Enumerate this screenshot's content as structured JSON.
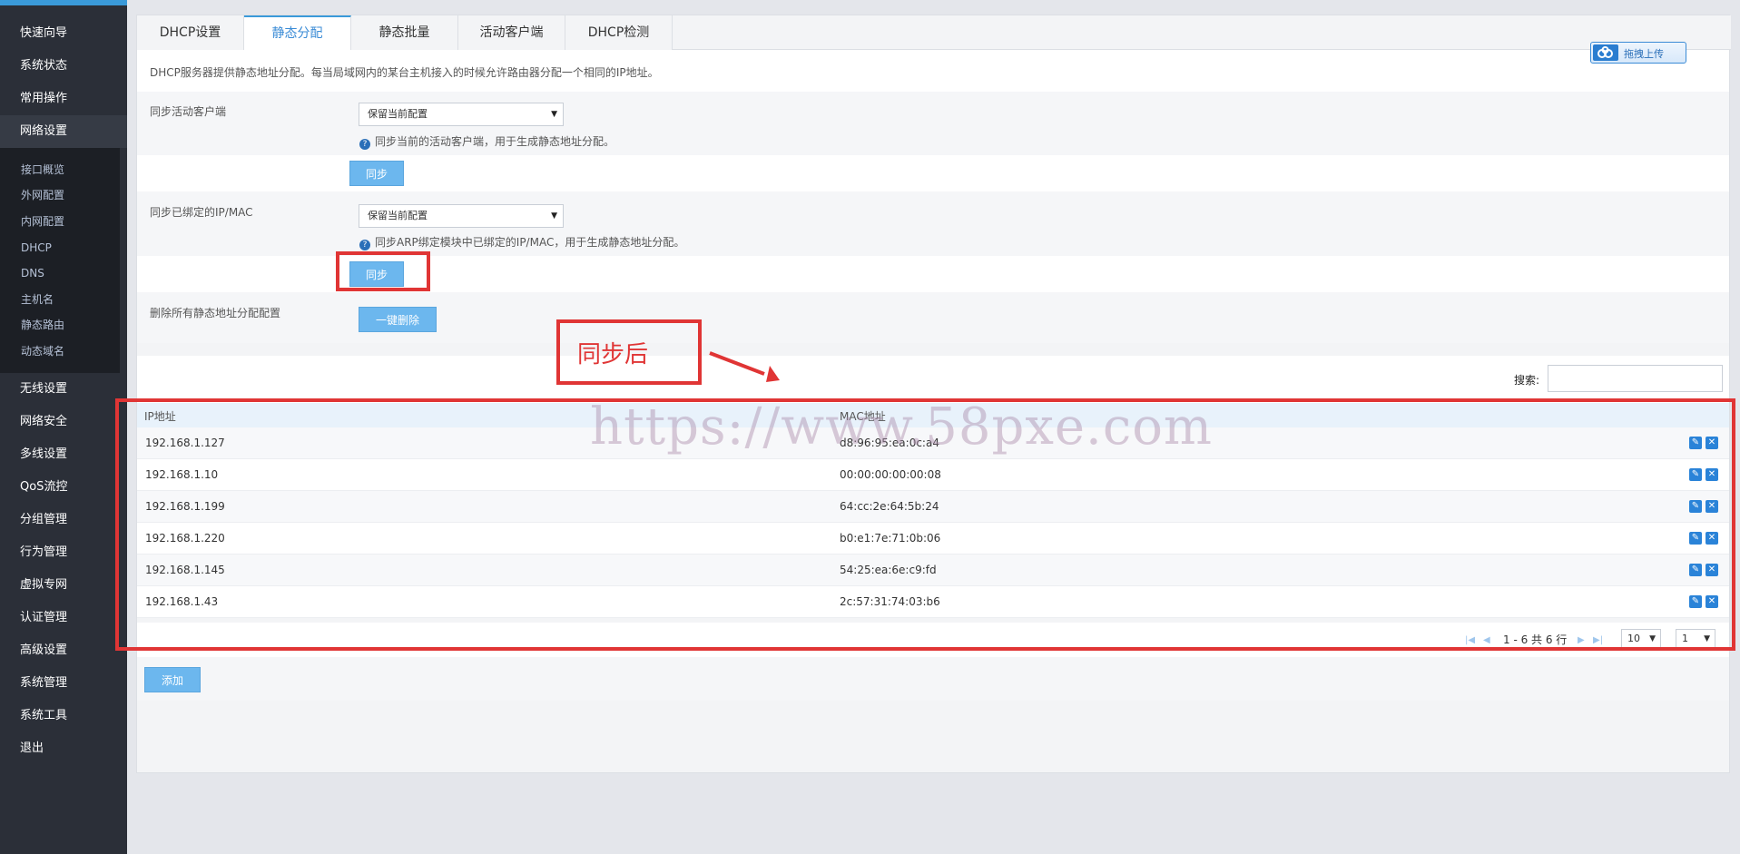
{
  "sidebar": {
    "items": [
      {
        "label": "快速向导"
      },
      {
        "label": "系统状态"
      },
      {
        "label": "常用操作"
      },
      {
        "label": "网络设置"
      },
      {
        "label": "无线设置"
      },
      {
        "label": "网络安全"
      },
      {
        "label": "多线设置"
      },
      {
        "label": "QoS流控"
      },
      {
        "label": "分组管理"
      },
      {
        "label": "行为管理"
      },
      {
        "label": "虚拟专网"
      },
      {
        "label": "认证管理"
      },
      {
        "label": "高级设置"
      },
      {
        "label": "系统管理"
      },
      {
        "label": "系统工具"
      },
      {
        "label": "退出"
      }
    ],
    "submenu": [
      {
        "label": "接口概览"
      },
      {
        "label": "外网配置"
      },
      {
        "label": "内网配置"
      },
      {
        "label": "DHCP"
      },
      {
        "label": "DNS"
      },
      {
        "label": "主机名"
      },
      {
        "label": "静态路由"
      },
      {
        "label": "动态域名"
      }
    ]
  },
  "tabs": [
    {
      "label": "DHCP设置"
    },
    {
      "label": "静态分配"
    },
    {
      "label": "静态批量"
    },
    {
      "label": "活动客户端"
    },
    {
      "label": "DHCP检测"
    }
  ],
  "upload": {
    "label": "拖拽上传"
  },
  "description": "DHCP服务器提供静态地址分配。每当局域网内的某台主机接入的时候允许路由器分配一个相同的IP地址。",
  "sync_active": {
    "label": "同步活动客户端",
    "select_value": "保留当前配置",
    "hint": "同步当前的活动客户端，用于生成静态地址分配。",
    "button": "同步"
  },
  "sync_bound": {
    "label": "同步已绑定的IP/MAC",
    "select_value": "保留当前配置",
    "hint": "同步ARP绑定模块中已绑定的IP/MAC，用于生成静态地址分配。",
    "button": "同步"
  },
  "delete_all": {
    "label": "删除所有静态地址分配配置",
    "button": "一键删除"
  },
  "callout": {
    "text": "同步后"
  },
  "search": {
    "label": "搜索:",
    "value": ""
  },
  "table": {
    "columns": [
      "IP地址",
      "MAC地址"
    ],
    "rows": [
      {
        "ip": "192.168.1.127",
        "mac": "d8:96:95:ea:0c:a4"
      },
      {
        "ip": "192.168.1.10",
        "mac": "00:00:00:00:00:08"
      },
      {
        "ip": "192.168.1.199",
        "mac": "64:cc:2e:64:5b:24"
      },
      {
        "ip": "192.168.1.220",
        "mac": "b0:e1:7e:71:0b:06"
      },
      {
        "ip": "192.168.1.145",
        "mac": "54:25:ea:6e:c9:fd"
      },
      {
        "ip": "192.168.1.43",
        "mac": "2c:57:31:74:03:b6"
      }
    ]
  },
  "pager": {
    "summary": "1 - 6 共 6 行",
    "page_size": "10",
    "page": "1"
  },
  "add_button": "添加",
  "watermark": "https://www.58pxe.com",
  "colors": {
    "sidebar_bg": "#2b2f38",
    "accent": "#3a9ad9",
    "button_blue": "#6cb7ee",
    "annotation_red": "#e03535"
  }
}
